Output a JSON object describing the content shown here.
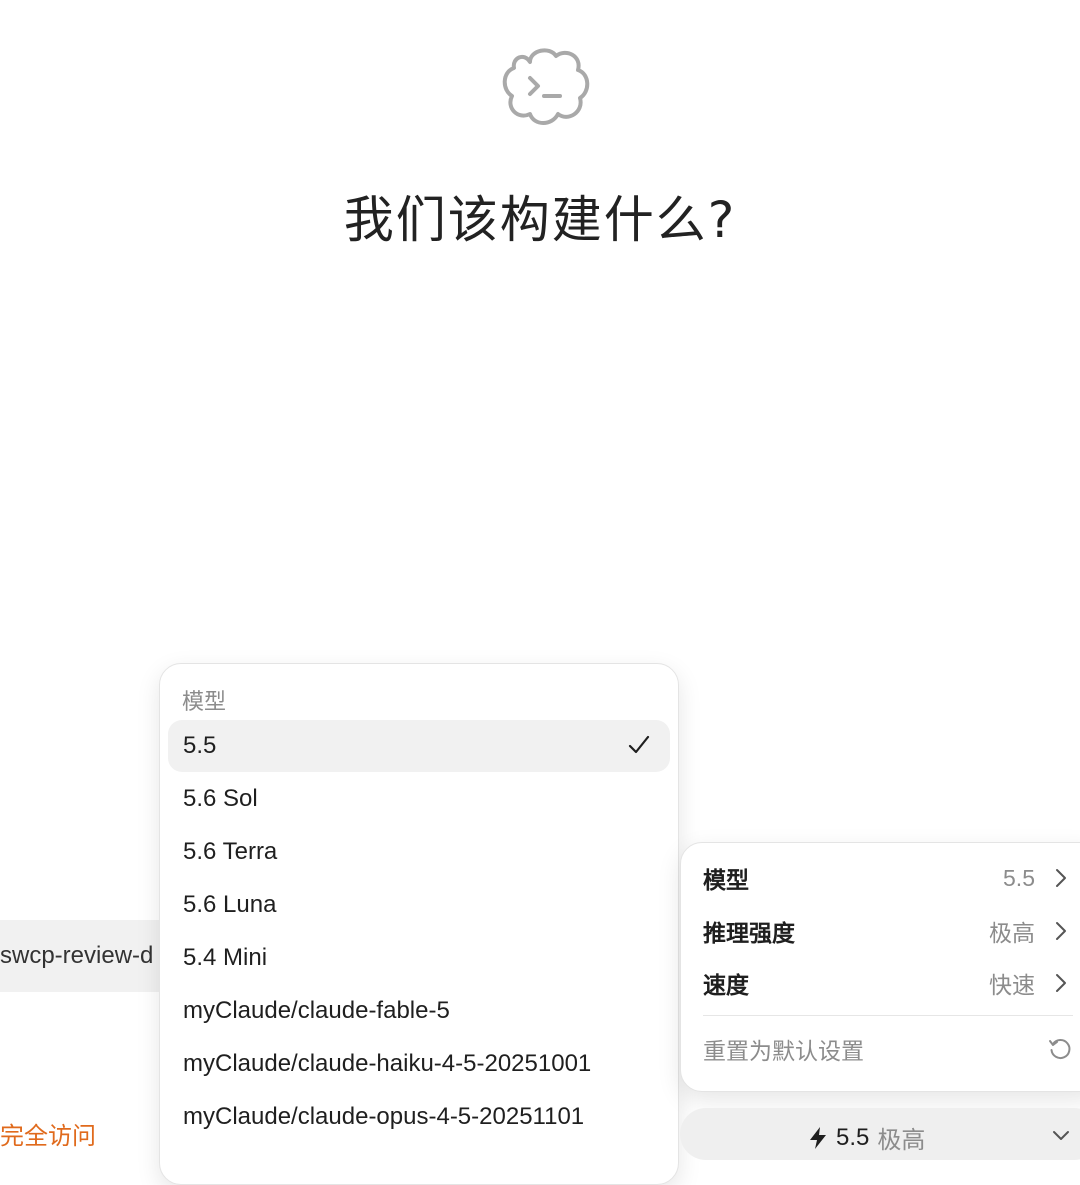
{
  "header": {
    "title": "我们该构建什么?",
    "logo_icon": "cloud-terminal-icon"
  },
  "background": {
    "tag_text": "swcp-review-d",
    "access_text": "完全访问",
    "access_color": "#e06a1c"
  },
  "model_menu": {
    "header": "模型",
    "items": [
      {
        "label": "5.5",
        "selected": true
      },
      {
        "label": "5.6 Sol",
        "selected": false
      },
      {
        "label": "5.6 Terra",
        "selected": false
      },
      {
        "label": "5.6 Luna",
        "selected": false
      },
      {
        "label": "5.4 Mini",
        "selected": false
      },
      {
        "label": "myClaude/claude-fable-5",
        "selected": false
      },
      {
        "label": "myClaude/claude-haiku-4-5-20251001",
        "selected": false
      },
      {
        "label": "myClaude/claude-opus-4-5-20251101",
        "selected": false
      }
    ],
    "selected_icon": "checkmark-icon"
  },
  "settings": {
    "rows": [
      {
        "label": "模型",
        "value": "5.5"
      },
      {
        "label": "推理强度",
        "value": "极高"
      },
      {
        "label": "速度",
        "value": "快速"
      }
    ],
    "reset_label": "重置为默认设置",
    "reset_icon": "reset-icon"
  },
  "pill": {
    "model": "5.5",
    "effort": "极高",
    "icon": "bolt-icon"
  }
}
